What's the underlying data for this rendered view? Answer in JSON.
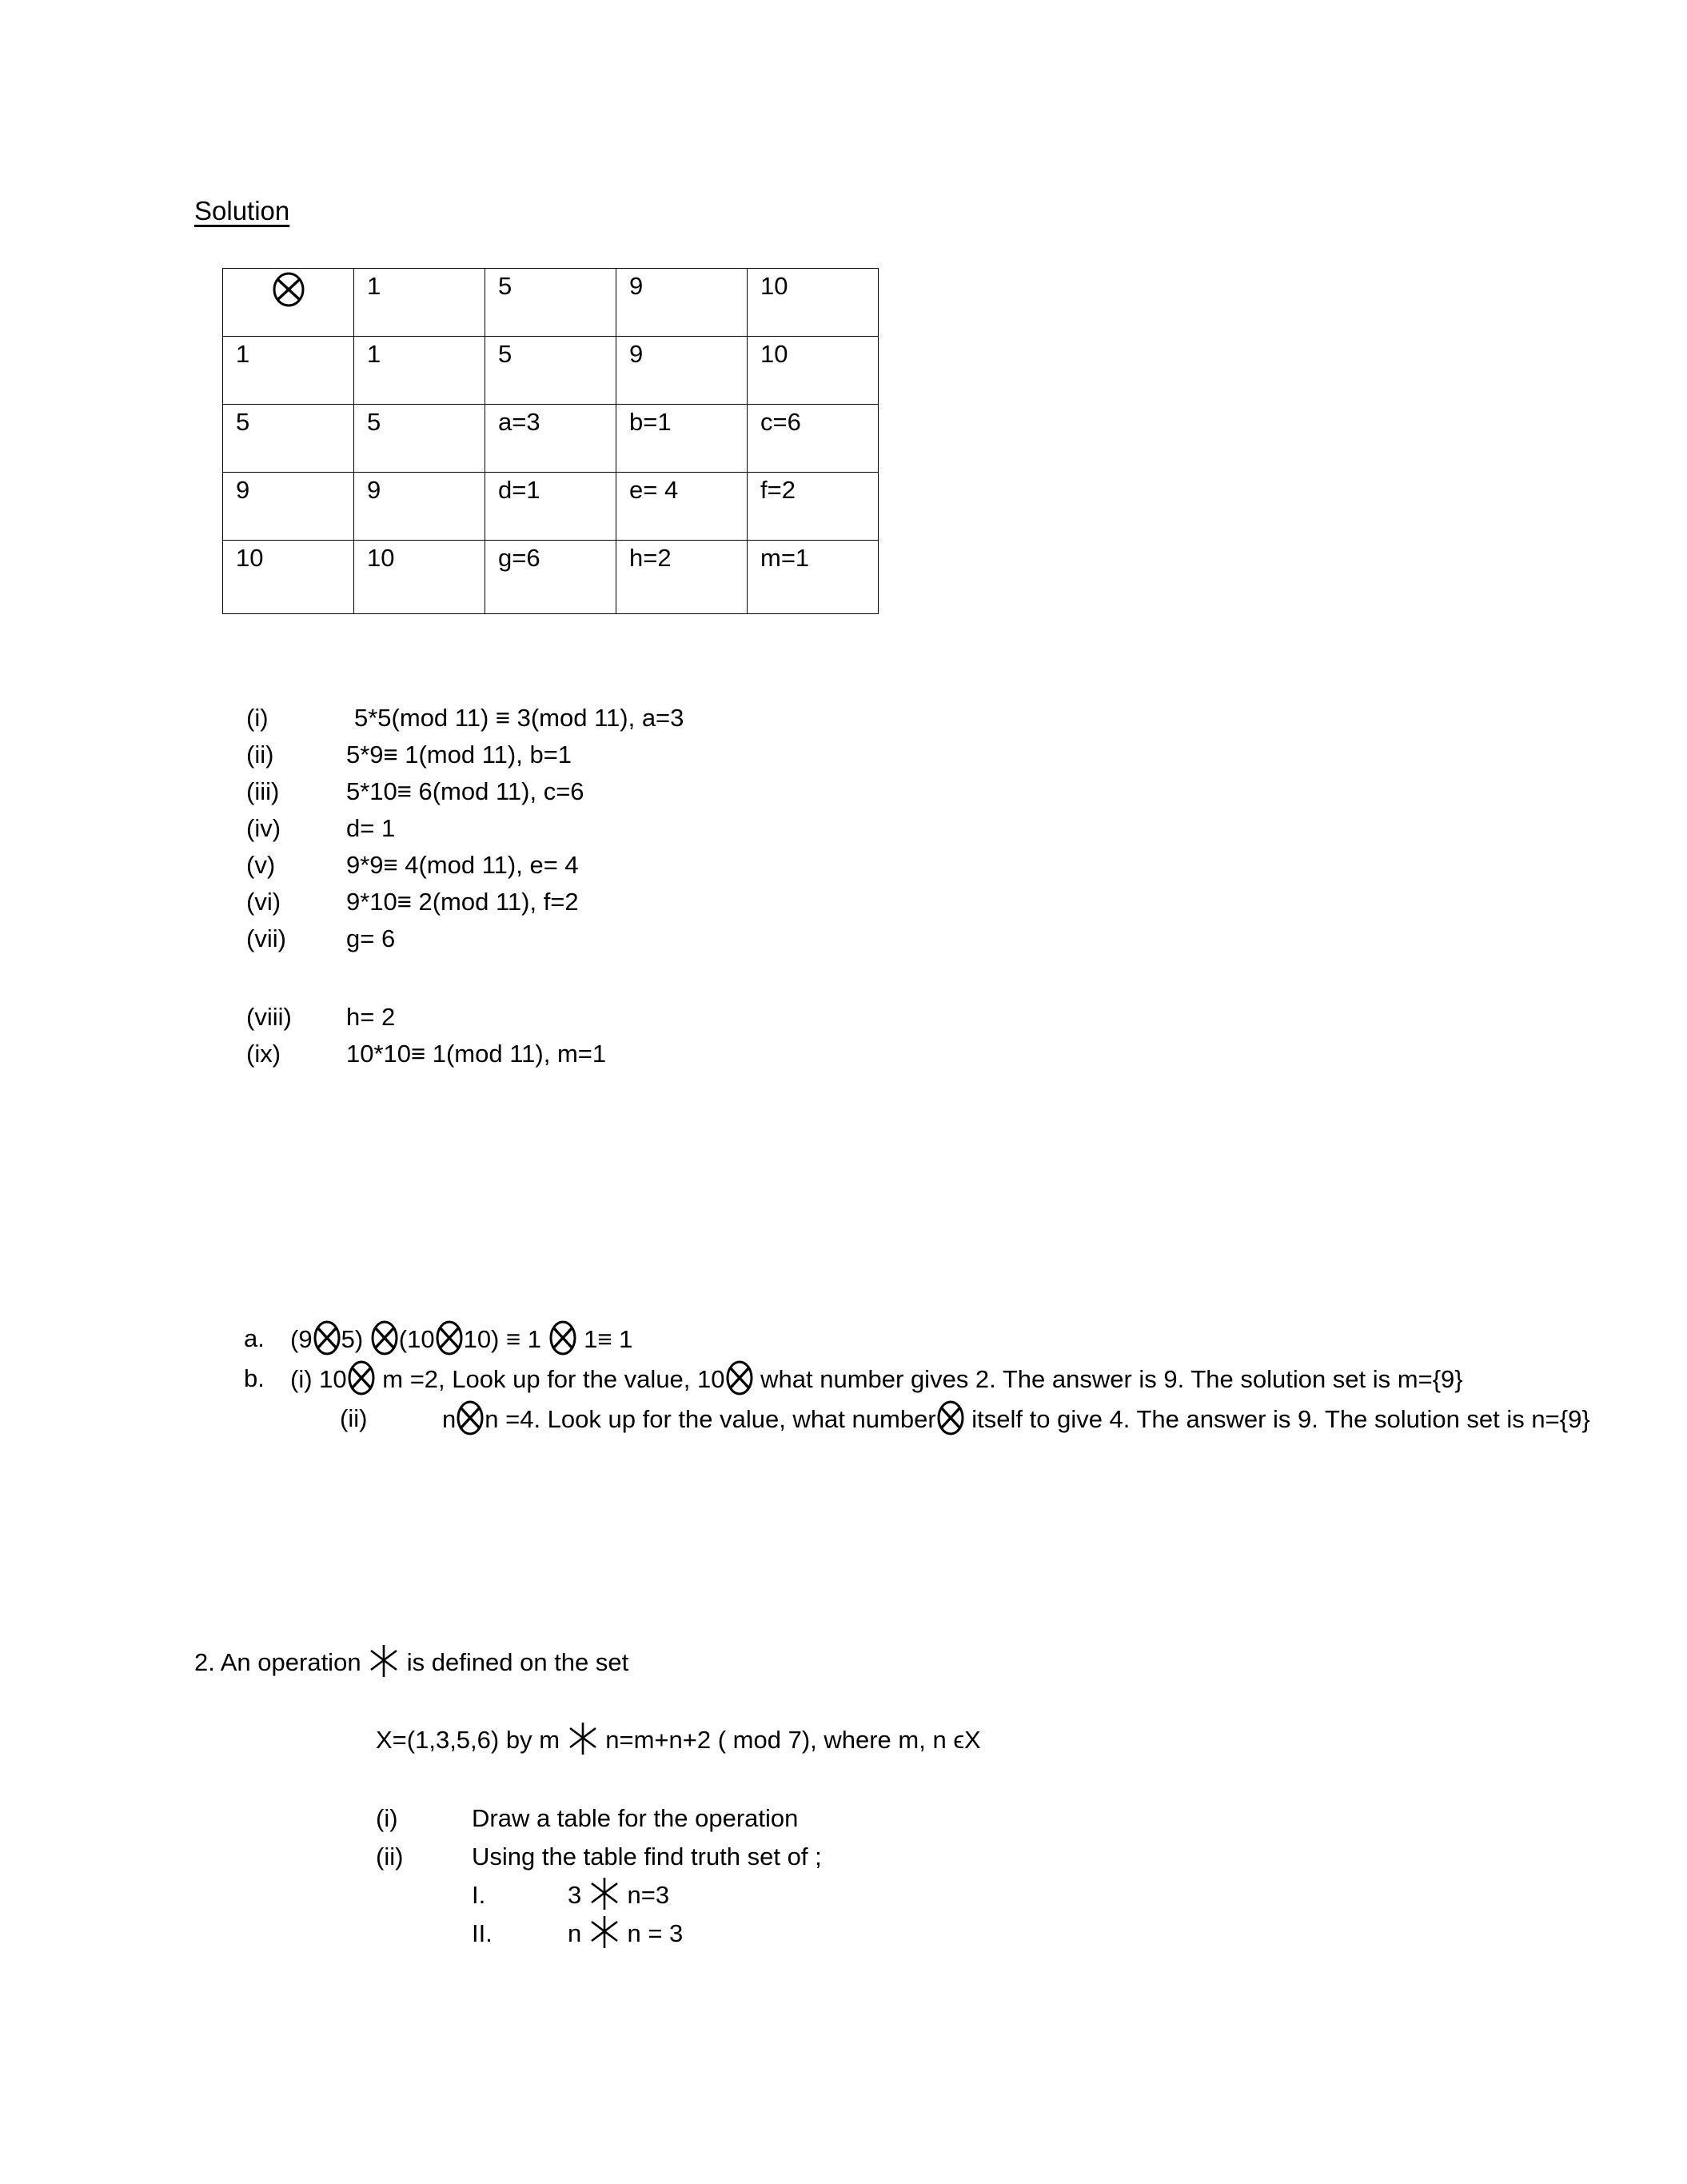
{
  "document": {
    "heading": "Solution"
  },
  "cayley_table": {
    "operator_symbol": "circled-times",
    "rows": [
      [
        "⊗",
        "1",
        "5",
        "9",
        "10"
      ],
      [
        "1",
        "1",
        "5",
        "9",
        "10"
      ],
      [
        "5",
        "5",
        "a=3",
        "b=1",
        "c=6"
      ],
      [
        "9",
        "9",
        "d=1",
        "e= 4",
        "f=2"
      ],
      [
        "10",
        "10",
        "g=6",
        "h=2",
        "m=1"
      ]
    ]
  },
  "workings": {
    "items": [
      {
        "marker": "(i)",
        "text": "5*5(mod 11) ≡ 3(mod 11), a=3"
      },
      {
        "marker": "(ii)",
        "text": "5*9≡ 1(mod 11), b=1"
      },
      {
        "marker": "(iii)",
        "text": "5*10≡ 6(mod 11), c=6"
      },
      {
        "marker": "(iv)",
        "text": "d= 1"
      },
      {
        "marker": "(v)",
        "text": "9*9≡ 4(mod 11), e= 4"
      },
      {
        "marker": "(vi)",
        "text": "9*10≡ 2(mod 11), f=2"
      },
      {
        "marker": "(vii)",
        "text": "g= 6"
      },
      {
        "marker": "(viii)",
        "text": "h= 2"
      },
      {
        "marker": "(ix)",
        "text": "10*10≡ 1(mod 11), m=1"
      }
    ]
  },
  "answers": {
    "a": {
      "letter": "a.",
      "part1": "(9",
      "part2": "5) ",
      "part3": "(10",
      "part4": "10) ≡ 1 ",
      "part5": " 1≡ 1"
    },
    "b": {
      "letter": "b.",
      "i_pre": "(i) 10",
      "i_mid": " m =2,  Look up for the value, 10",
      "i_post": " what number gives 2. The answer is 9.  The solution set is m={9}",
      "ii_marker": "(ii)",
      "ii_pre": "n",
      "ii_mid": "n =4.  Look up for the value, what number",
      "ii_post": " itself to give 4.  The answer is 9. The solution set is n={9}"
    }
  },
  "question2": {
    "intro_pre": "2. An operation ",
    "intro_post": " is defined on the set",
    "definition_pre": "X=(1,3,5,6) by m ",
    "definition_post": " n=m+n+2 ( mod 7), where m, n ϵX",
    "items": [
      {
        "marker": "(i)",
        "text": "Draw a table for the operation"
      },
      {
        "marker": "(ii)",
        "text": "Using the table find truth set of ;"
      }
    ],
    "subitems": [
      {
        "marker": "I.",
        "pre": "3 ",
        "post": " n=3"
      },
      {
        "marker": "II.",
        "pre": "n ",
        "post": " n = 3"
      }
    ]
  }
}
